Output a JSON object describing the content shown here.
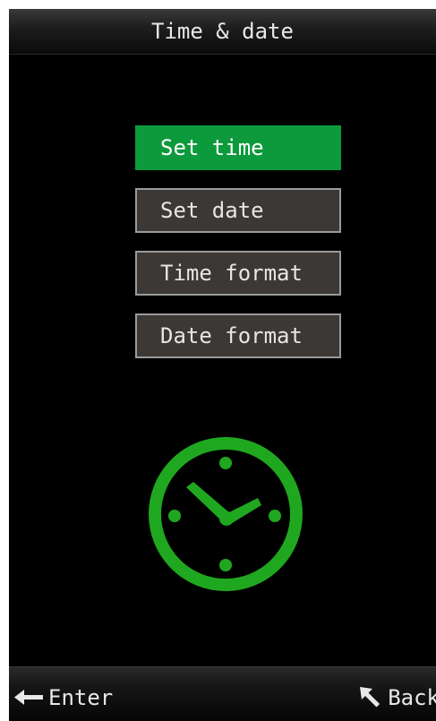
{
  "header": {
    "title": "Time & date"
  },
  "menu": {
    "items": [
      {
        "label": "Set time",
        "selected": true
      },
      {
        "label": "Set date",
        "selected": false
      },
      {
        "label": "Time format",
        "selected": false
      },
      {
        "label": "Date format",
        "selected": false
      }
    ]
  },
  "illustration": {
    "icon": "clock-icon",
    "color": "#1fa81f"
  },
  "softkeys": {
    "left": {
      "label": "Enter",
      "icon": "enter-arrow-icon"
    },
    "right": {
      "label": "Back",
      "icon": "back-arrow-icon"
    }
  },
  "colors": {
    "background": "#000000",
    "selected": "#0d9a3c",
    "item_background": "#3b3836",
    "item_border": "#9a9a9a",
    "text": "#e8e8e8"
  }
}
